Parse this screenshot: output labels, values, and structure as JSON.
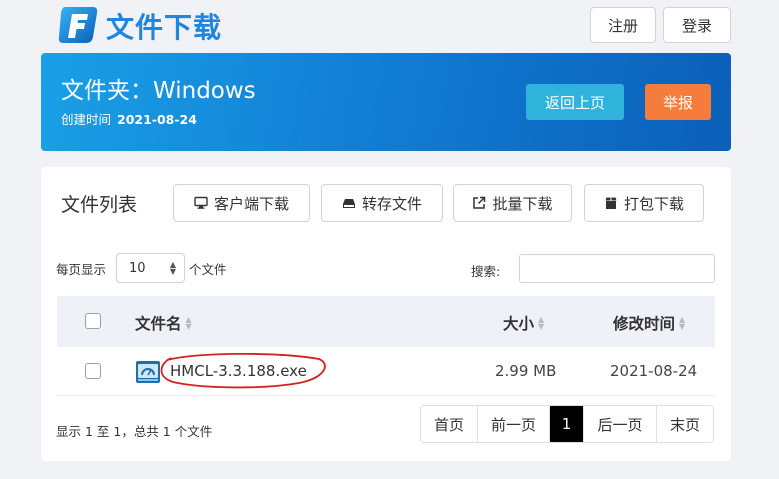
{
  "header": {
    "site_title": "文件下载",
    "register_label": "注册",
    "login_label": "登录"
  },
  "folder": {
    "title": "文件夹：Windows",
    "created_label": "创建时间",
    "created_date": "2021-08-24",
    "back_label": "返回上页",
    "report_label": "举报"
  },
  "file_list": {
    "title": "文件列表",
    "toolbar": {
      "client_download": "客户端下载",
      "save_file": "转存文件",
      "batch_download": "批量下载",
      "pack_download": "打包下载"
    },
    "per_page_prefix": "每页显示",
    "per_page_value": "10",
    "per_page_suffix": "个文件",
    "search_label": "搜索:",
    "search_value": "",
    "columns": {
      "name": "文件名",
      "size": "大小",
      "modified": "修改时间"
    },
    "rows": [
      {
        "name": "HMCL-3.3.188.exe",
        "size": "2.99 MB",
        "modified": "2021-08-24"
      }
    ],
    "summary": "显示 1 至 1，总共 1 个文件",
    "pagination": {
      "first": "首页",
      "prev": "前一页",
      "current": "1",
      "next": "后一页",
      "last": "末页"
    }
  },
  "colors": {
    "brand": "#1f86e0",
    "banner_start": "#1aa0e6",
    "banner_end": "#0b5fb8",
    "back_button": "#2fb3db",
    "report_button": "#f57c3a",
    "annotation": "#d42020"
  }
}
